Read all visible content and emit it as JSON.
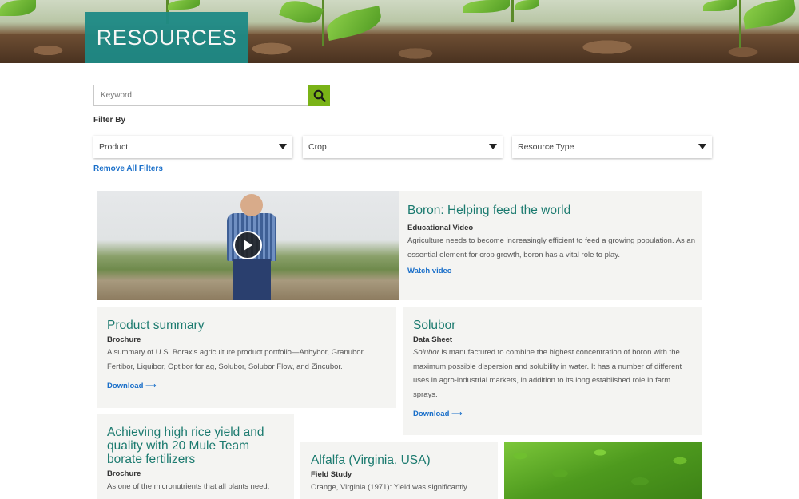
{
  "hero": {
    "title": "RESOURCES"
  },
  "search": {
    "placeholder": "Keyword",
    "button_icon": "search-icon"
  },
  "filters": {
    "label": "Filter By",
    "dropdowns": [
      {
        "label": "Product"
      },
      {
        "label": "Crop"
      },
      {
        "label": "Resource Type"
      }
    ],
    "remove_all": "Remove All Filters"
  },
  "colors": {
    "accent_teal": "#1b7a6f",
    "search_green": "#7ab317",
    "link_blue": "#1a6fc9",
    "hero_box": "#1e8a86"
  },
  "cards": [
    {
      "title": "Boron: Helping feed the world",
      "type": "Educational Video",
      "description": "Agriculture needs to become increasingly efficient to feed a growing population. As an essential element for crop growth, boron has a vital role to play.",
      "link": "Watch video"
    },
    {
      "title": "Product summary",
      "type": "Brochure",
      "description": "A summary of U.S. Borax's agriculture product portfolio—Anhybor, Granubor, Fertibor, Liquibor, Optibor for ag, Solubor, Solubor Flow, and Zincubor.",
      "link": "Download"
    },
    {
      "title": "Solubor",
      "type": "Data Sheet",
      "description_em": "Solubor",
      "description": " is manufactured to combine the highest concentration of boron with the maximum possible dispersion and solubility in water. It has a number of different uses in agro-industrial markets, in addition to its long established role in farm sprays.",
      "link": "Download"
    },
    {
      "title": "Achieving high rice yield and quality with 20 Mule Team borate fertilizers",
      "type": "Brochure",
      "description": "As one of the micronutrients that all plants need,"
    },
    {
      "title": "Alfalfa (Virginia, USA)",
      "type": "Field Study",
      "description": "Orange, Virginia (1971): Yield was significantly"
    }
  ],
  "link_arrow": "⟶"
}
